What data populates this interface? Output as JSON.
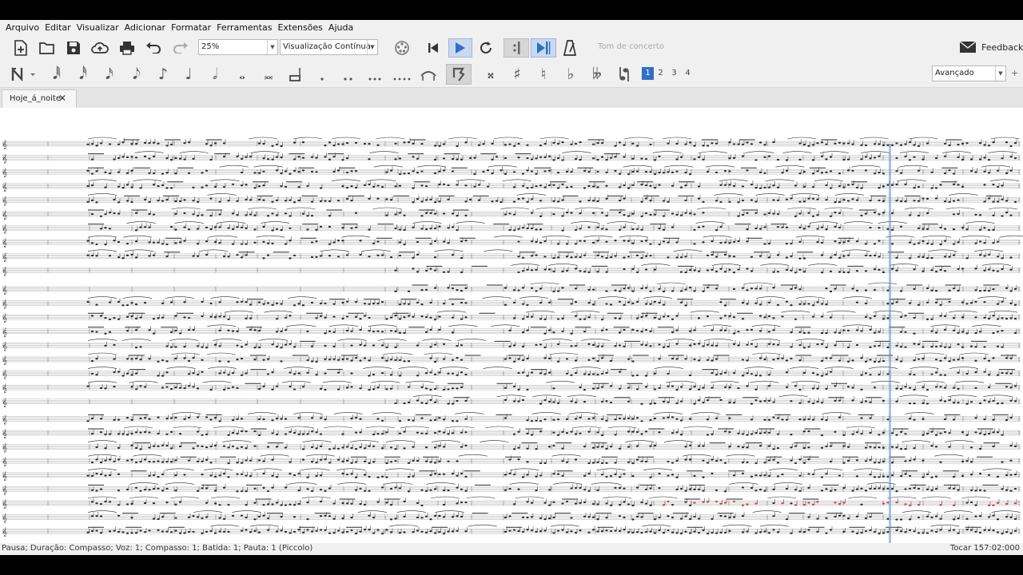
{
  "menu": [
    "Arquivo",
    "Editar",
    "Visualizar",
    "Adicionar",
    "Formatar",
    "Ferramentas",
    "Extensões",
    "Ajuda"
  ],
  "toolbar": {
    "zoom_value": "25%",
    "view_mode": "Visualização Contínua",
    "concert_pitch_label": "Tom de concerto",
    "feedback_label": "Feedback",
    "icons": [
      "new-file-icon",
      "open-folder-icon",
      "save-icon",
      "cloud-upload-icon",
      "print-icon",
      "undo-icon",
      "redo-icon",
      "mixer-icon",
      "rewind-icon",
      "play-icon",
      "loop-icon",
      "loop-in-icon",
      "loop-out-icon",
      "metronome-icon",
      "envelope-icon"
    ]
  },
  "note_input": {
    "durations": [
      "𝅘𝅥𝅱",
      "𝅘𝅥𝅰",
      "𝅘𝅥𝅯",
      "𝅘𝅥𝅮",
      "♪",
      "♩",
      "𝅗𝅥",
      "𝅝",
      "𝅜"
    ],
    "accidentals": [
      "𝄪",
      "♯",
      "♮",
      "♭",
      "𝄫"
    ],
    "voices": [
      "1",
      "2",
      "3",
      "4"
    ],
    "active_voice": "1",
    "workspace": "Avançado"
  },
  "tabs": [
    {
      "label": "Hoje_á_noite"
    }
  ],
  "status": {
    "left": "Pausa; Duração: Compasso; Voz: 1;  Compasso: 1; Batida: 1; Pauta: 1 (Piccolo)",
    "right": "Tocar  157:02:000"
  },
  "colors": {
    "accent": "#2f6fc8",
    "playhead": "#5b8fd6",
    "staff": "#b5b5b5",
    "notation": "#2a2a2a",
    "red_notes": "#d43a3a"
  }
}
